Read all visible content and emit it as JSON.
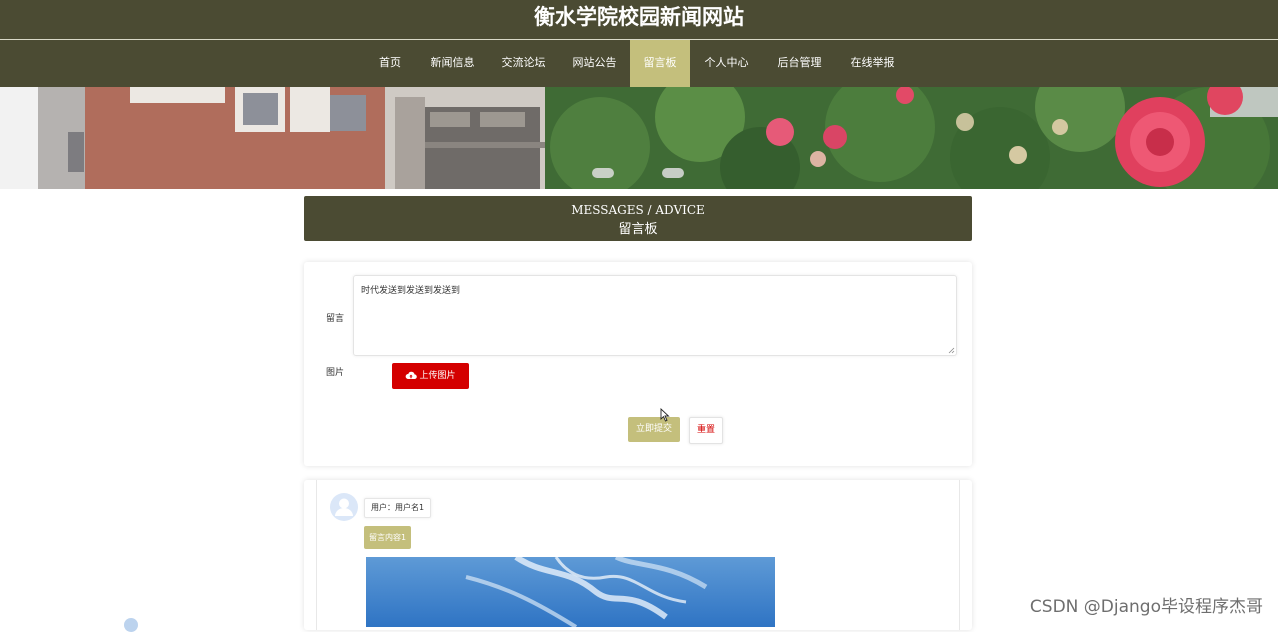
{
  "header": {
    "site_title": "衡水学院校园新闻网站"
  },
  "nav": {
    "items": [
      {
        "label": "首页"
      },
      {
        "label": "新闻信息"
      },
      {
        "label": "交流论坛"
      },
      {
        "label": "网站公告"
      },
      {
        "label": "留言板"
      },
      {
        "label": "个人中心"
      },
      {
        "label": "后台管理"
      },
      {
        "label": "在线举报"
      }
    ],
    "active_label": "留言板"
  },
  "section": {
    "title_en": "MESSAGES / ADVICE",
    "title_cn": "留言板"
  },
  "form": {
    "message_label": "留言",
    "message_value": "时代发送到发送到发送到",
    "image_label": "图片",
    "upload_label": "上传图片",
    "submit_label": "立即提交",
    "reset_label": "重置"
  },
  "messages": [
    {
      "user_text": "用户：用户名1",
      "content": "留言内容1"
    }
  ],
  "watermark": "CSDN @Django毕设程序杰哥",
  "colors": {
    "header_bg": "#4b4b33",
    "accent": "#c4bf7c",
    "danger": "#d40000"
  },
  "icons": [
    "cloud-upload-icon",
    "avatar-icon",
    "resize-handle-icon",
    "mouse-cursor-icon"
  ]
}
